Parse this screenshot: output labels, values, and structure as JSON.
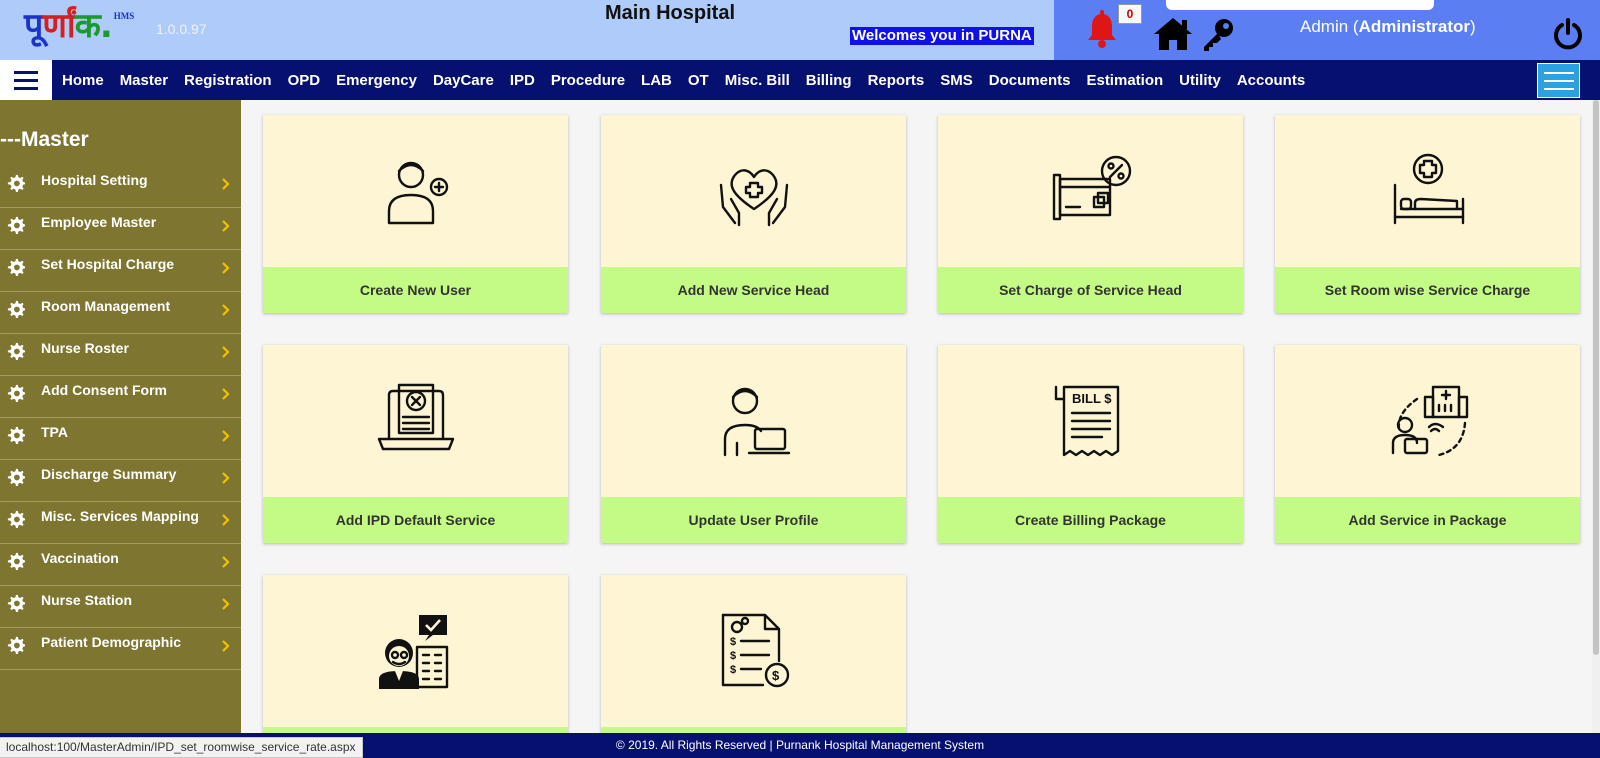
{
  "header": {
    "logo": {
      "part1": "पू",
      "part2": "र्णां",
      "part3": "क.",
      "sup": "HMS"
    },
    "version": "1.0.0.97",
    "hospital_name": "Main Hospital",
    "welcome": "Welcomes you in PURNA",
    "notification_count": "0",
    "user_prefix": "Admin (",
    "user_role": "Administrator",
    "user_suffix": ")",
    "icons": [
      "bell-icon",
      "home-icon",
      "key-icon",
      "power-icon"
    ]
  },
  "nav": {
    "items": [
      "Home",
      "Master",
      "Registration",
      "OPD",
      "Emergency",
      "DayCare",
      "IPD",
      "Procedure",
      "LAB",
      "OT",
      "Misc. Bill",
      "Billing",
      "Reports",
      "SMS",
      "Documents",
      "Estimation",
      "Utility",
      "Accounts"
    ]
  },
  "sidebar": {
    "title": "---Master",
    "items": [
      {
        "label": "Hospital Setting"
      },
      {
        "label": "Employee Master"
      },
      {
        "label": "Set Hospital Charge"
      },
      {
        "label": "Room Management"
      },
      {
        "label": "Nurse Roster"
      },
      {
        "label": "Add Consent Form"
      },
      {
        "label": "TPA"
      },
      {
        "label": "Discharge Summary"
      },
      {
        "label": "Misc. Services Mapping"
      },
      {
        "label": "Vaccination"
      },
      {
        "label": "Nurse Station"
      },
      {
        "label": "Patient Demographic"
      }
    ]
  },
  "tiles": [
    {
      "label": "Create New User",
      "icon": "add-user-icon"
    },
    {
      "label": "Add New Service Head",
      "icon": "care-heart-icon"
    },
    {
      "label": "Set Charge of Service Head",
      "icon": "discount-card-icon"
    },
    {
      "label": "Set Room wise Service Charge",
      "icon": "hospital-bed-icon"
    },
    {
      "label": "Add IPD Default Service",
      "icon": "laptop-document-icon"
    },
    {
      "label": "Update User Profile",
      "icon": "user-laptop-icon"
    },
    {
      "label": "Create Billing Package",
      "icon": "bill-icon"
    },
    {
      "label": "Add Service in Package",
      "icon": "remote-hospital-icon"
    },
    {
      "label": "",
      "icon": "doctor-building-icon"
    },
    {
      "label": "",
      "icon": "invoice-dollar-icon"
    }
  ],
  "footer": {
    "text": "© 2019. All Rights Reserved | Purnank Hospital Management System"
  },
  "status_url": "localhost:100/MasterAdmin/IPD_set_roomwise_service_rate.aspx",
  "colors": {
    "header_bg": "#aecbfa",
    "header_right_bg": "#5b7ef2",
    "navbar_bg": "#06106e",
    "sidebar_bg": "#7d7530",
    "tile_bg": "#fdf5d3",
    "tile_label_bg": "#c4fb84",
    "welcome_bg": "#1010e8"
  }
}
